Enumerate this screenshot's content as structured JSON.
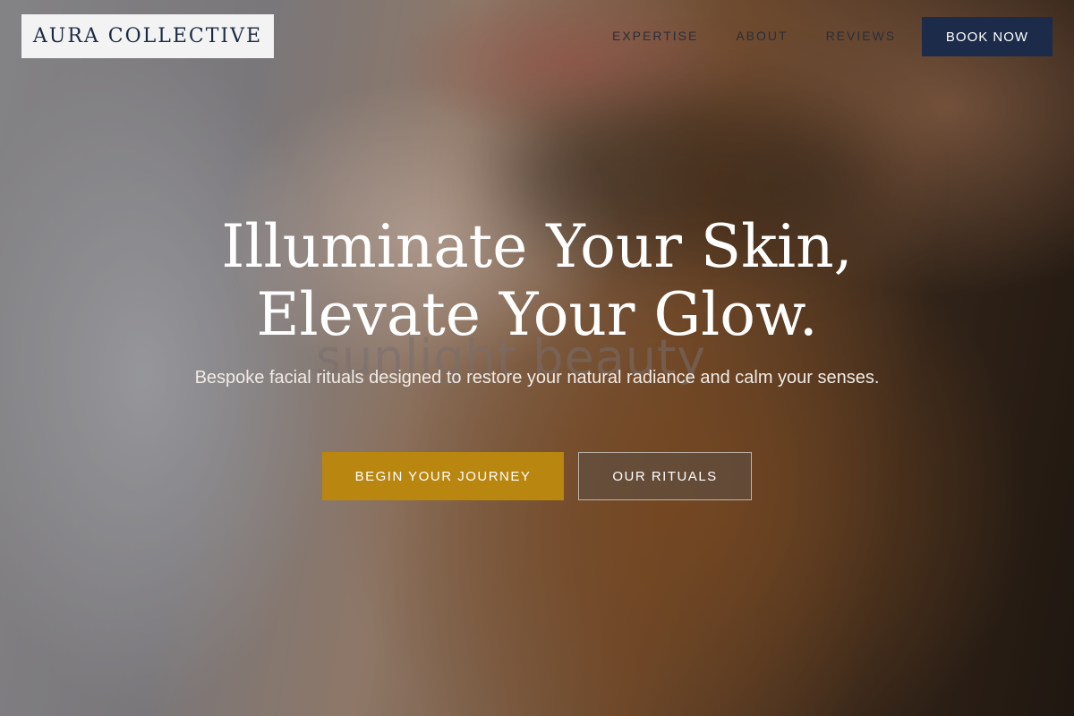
{
  "brand": {
    "name": "AURA COLLECTIVE"
  },
  "nav": {
    "items": [
      {
        "label": "EXPERTISE"
      },
      {
        "label": "ABOUT"
      },
      {
        "label": "REVIEWS"
      }
    ],
    "cta_label": "BOOK NOW"
  },
  "hero": {
    "headline_line1": "Illuminate Your Skin,",
    "headline_line2": "Elevate Your Glow.",
    "watermark_text": "sunlight beauty",
    "subtitle": "Bespoke facial rituals designed to restore your natural radiance and calm your senses.",
    "primary_cta": "BEGIN YOUR JOURNEY",
    "secondary_cta": "OUR RITUALS"
  },
  "colors": {
    "navy": "#1d2b4a",
    "gold": "#b9860f",
    "logo_bg": "#f3f3f3"
  }
}
